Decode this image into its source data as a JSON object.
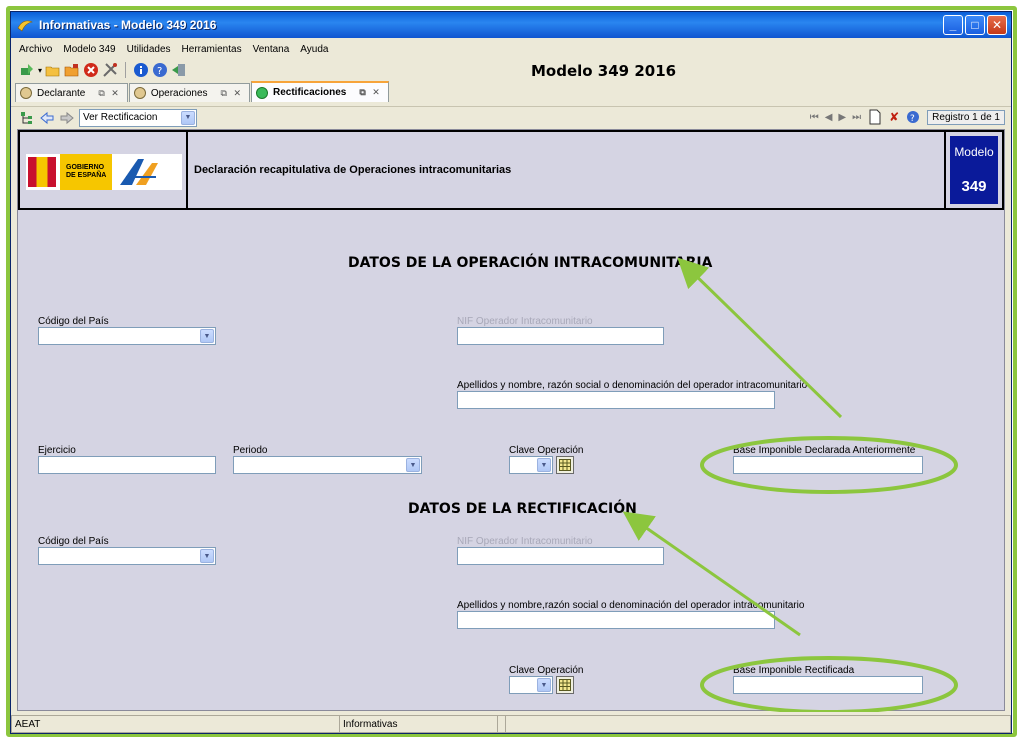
{
  "window": {
    "title": "Informativas - Modelo 349 2016"
  },
  "menu": [
    "Archivo",
    "Modelo 349",
    "Utilidades",
    "Herramientas",
    "Ventana",
    "Ayuda"
  ],
  "form_title": "Modelo 349 2016",
  "tabs": [
    {
      "label": "Declarante"
    },
    {
      "label": "Operaciones"
    },
    {
      "label": "Rectificaciones"
    }
  ],
  "nav": {
    "view_select": "Ver Rectificacion",
    "registro": "Registro 1 de 1"
  },
  "header": {
    "gov_line1": "GOBIERNO",
    "gov_line2": "DE ESPAÑA",
    "description": "Declaración recapitulativa de Operaciones intracomunitarias",
    "modelo_label": "Modelo",
    "modelo_number": "349"
  },
  "section1": {
    "title": "DATOS DE LA OPERACIÓN INTRACOMUNITARIA",
    "codigo_pais": "Código del País",
    "nif": "NIF Operador Intracomunitario",
    "apellidos": "Apellidos y nombre, razón social o denominación del operador intracomunitario",
    "ejercicio": "Ejercicio",
    "periodo": "Periodo",
    "clave": "Clave Operación",
    "base": "Base Imponible Declarada Anteriormente"
  },
  "section2": {
    "title": "DATOS DE LA RECTIFICACIÓN",
    "codigo_pais": "Código del País",
    "nif": "NIF Operador Intracomunitario",
    "apellidos": "Apellidos y nombre,razón social o denominación del operador intracomunitario",
    "clave": "Clave Operación",
    "base": "Base Imponible Rectificada"
  },
  "status": [
    "AEAT",
    "Informativas",
    "",
    ""
  ],
  "colors": {
    "annotation": "#8cc63e",
    "modelo_box": "#0a1a9a",
    "content_bg": "#d5d4e3"
  }
}
